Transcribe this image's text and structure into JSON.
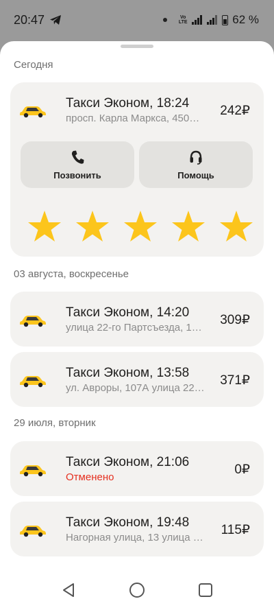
{
  "status_bar": {
    "time": "20:47",
    "battery": "62 %",
    "network": "Vo LTE"
  },
  "sections": [
    {
      "title": "Сегодня"
    },
    {
      "title": "03 августа, воскресенье"
    },
    {
      "title": "29 июля, вторник"
    }
  ],
  "active_ride": {
    "title": "Такси Эконом, 18:24",
    "address": "просп. Карла Маркса, 450…",
    "price": "242₽",
    "call_label": "Позвонить",
    "help_label": "Помощь",
    "rating_stars": 5
  },
  "rides": [
    {
      "title": "Такси Эконом, 14:20",
      "subtitle": "улица 22-го Партсъезда, 1…",
      "price": "309₽"
    },
    {
      "title": "Такси Эконом, 13:58",
      "subtitle": "ул. Авроры, 107А улица 22…",
      "price": "371₽"
    },
    {
      "title": "Такси Эконом, 21:06",
      "subtitle": "Отменено",
      "price": "0₽"
    },
    {
      "title": "Такси Эконом, 19:48",
      "subtitle": "Нагорная улица, 13 улица …",
      "price": "115₽"
    }
  ],
  "colors": {
    "star": "#fcc51c",
    "car": "#fcc51c",
    "cancelled": "#e52f1f"
  }
}
